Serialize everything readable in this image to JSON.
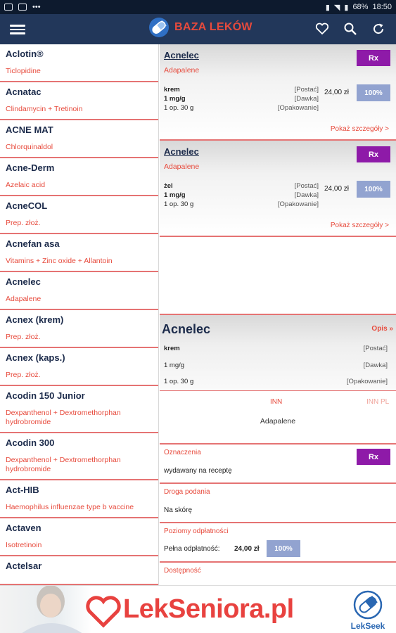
{
  "status_bar": {
    "battery": "68%",
    "time": "18:50"
  },
  "app": {
    "title": "BAZA LEKÓW"
  },
  "drug_list": [
    {
      "name": "Aclotin®",
      "sub": "Ticlopidine"
    },
    {
      "name": "Acnatac",
      "sub": "Clindamycin + Tretinoin"
    },
    {
      "name": "ACNE MAT",
      "sub": "Chlorquinaldol"
    },
    {
      "name": "Acne-Derm",
      "sub": "Azelaic acid"
    },
    {
      "name": "AcneCOL",
      "sub": "Prep. złoż."
    },
    {
      "name": "Acnefan asa",
      "sub": "Vitamins + Zinc oxide + Allantoin"
    },
    {
      "name": "Acnelec",
      "sub": "Adapalene"
    },
    {
      "name": "Acnex (krem)",
      "sub": "Prep. złoż."
    },
    {
      "name": "Acnex (kaps.)",
      "sub": "Prep. złoż."
    },
    {
      "name": "Acodin 150 Junior",
      "sub": "Dexpanthenol + Dextromethorphan hydrobromide"
    },
    {
      "name": "Acodin 300",
      "sub": "Dexpanthenol + Dextromethorphan hydrobromide"
    },
    {
      "name": "Act-HIB",
      "sub": "Haemophilus influenzae type b vaccine"
    },
    {
      "name": "Actaven",
      "sub": "Isotretinoin"
    },
    {
      "name": "Actelsar",
      "sub": ""
    }
  ],
  "variants": [
    {
      "title": "Acnelec",
      "inn": "Adapalene",
      "rx": "Rx",
      "form": "krem",
      "dose": "1 mg/g",
      "pack": "1 op. 30 g",
      "form_label": "[Postać]",
      "dose_label": "[Dawka]",
      "pack_label": "[Opakowanie]",
      "price": "24,00 zł",
      "refund": "100%",
      "more": "Pokaż szczegóły >"
    },
    {
      "title": "Acnelec",
      "inn": "Adapalene",
      "rx": "Rx",
      "form": "żel",
      "dose": "1 mg/g",
      "pack": "1 op. 30 g",
      "form_label": "[Postać]",
      "dose_label": "[Dawka]",
      "pack_label": "[Opakowanie]",
      "price": "24,00 zł",
      "refund": "100%",
      "more": "Pokaż szczegóły >"
    }
  ],
  "detail": {
    "title": "Acnelec",
    "opis": "Opis »",
    "form": "krem",
    "form_label": "[Postać]",
    "dose": "1 mg/g",
    "dose_label": "[Dawka]",
    "pack": "1 op. 30 g",
    "pack_label": "[Opakowanie]",
    "inn_tab": "INN",
    "inn_pl_tab": "INN PL",
    "inn_value": "Adapalene",
    "oznaczenia_label": "Oznaczenia",
    "oznaczenia_value": "wydawany na receptę",
    "rx": "Rx",
    "droga_label": "Droga podania",
    "droga_value": "Na skórę",
    "poziomy_label": "Poziomy odpłatności",
    "pelna_label": "Pełna odpłatność:",
    "pelna_price": "24,00 zł",
    "refund": "100%",
    "dostepnosc_label": "Dostępność"
  },
  "banner": {
    "text": "LekSeniora.pl",
    "lekseek": "LekSeek"
  },
  "colors": {
    "appbar": "#22375a",
    "accent": "#e74a3c",
    "rx": "#8e1aa8",
    "refund": "#92a3d0",
    "title": "#1b2a4a"
  }
}
